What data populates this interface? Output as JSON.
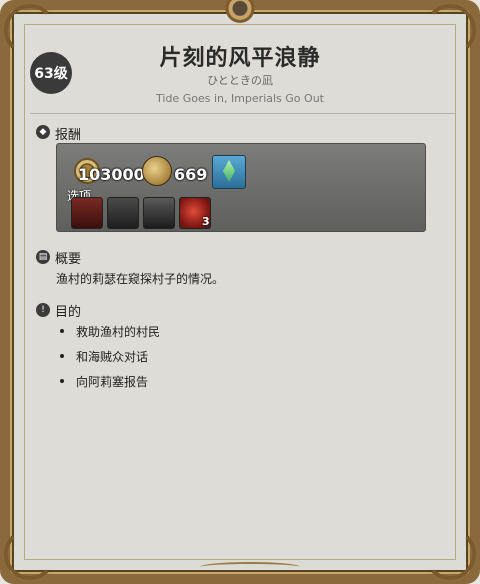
{
  "quest": {
    "level": "63级",
    "title": "片刻的风平浪静",
    "subtitle_jp": "ひとときの凪",
    "subtitle_en": "Tide Goes in, Imperials Go Out"
  },
  "rewards": {
    "label": "报酬",
    "gil": "103000",
    "currency": "669",
    "choose_label": "选项",
    "item_count": "3"
  },
  "summary": {
    "label": "概要",
    "text": "渔村的莉瑟在窥探村子的情况。"
  },
  "objectives": {
    "label": "目的",
    "items": [
      "救助渔村的村民",
      "和海贼众对话",
      "向阿莉塞报告"
    ]
  }
}
